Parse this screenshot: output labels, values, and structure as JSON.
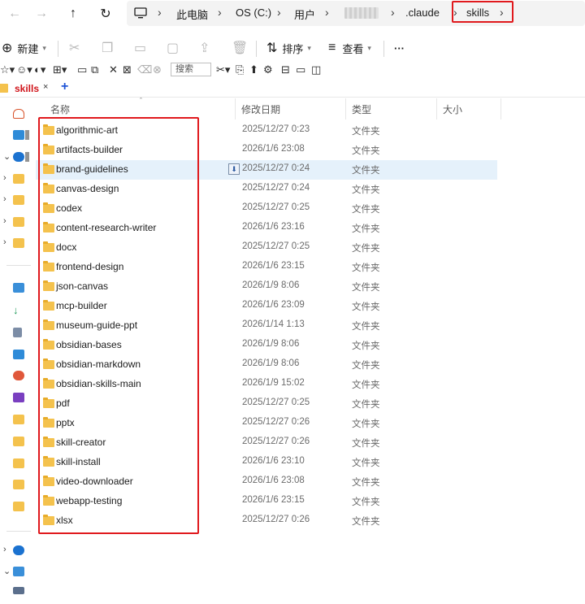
{
  "address_bar": {
    "breadcrumbs": [
      "此电脑",
      "OS (C:)",
      "用户",
      ".claude",
      "skills"
    ],
    "separator": "›"
  },
  "command_bar": {
    "new_label": "新建",
    "sort_label": "排序",
    "view_label": "查看",
    "more_label": "···"
  },
  "mini_toolbar": {
    "search_placeholder": "搜索"
  },
  "tab": {
    "label": "skills",
    "close": "×",
    "add": "+"
  },
  "columns": {
    "name": "名称",
    "modified": "修改日期",
    "type": "类型",
    "size": "大小"
  },
  "files": [
    {
      "name": "algorithmic-art",
      "modified": "2025/12/27 0:23",
      "type": "文件夹"
    },
    {
      "name": "artifacts-builder",
      "modified": "2026/1/6 23:08",
      "type": "文件夹"
    },
    {
      "name": "brand-guidelines",
      "modified": "2025/12/27 0:24",
      "type": "文件夹",
      "selected": true
    },
    {
      "name": "canvas-design",
      "modified": "2025/12/27 0:24",
      "type": "文件夹"
    },
    {
      "name": "codex",
      "modified": "2025/12/27 0:25",
      "type": "文件夹"
    },
    {
      "name": "content-research-writer",
      "modified": "2026/1/6 23:16",
      "type": "文件夹"
    },
    {
      "name": "docx",
      "modified": "2025/12/27 0:25",
      "type": "文件夹"
    },
    {
      "name": "frontend-design",
      "modified": "2026/1/6 23:15",
      "type": "文件夹"
    },
    {
      "name": "json-canvas",
      "modified": "2026/1/9 8:06",
      "type": "文件夹"
    },
    {
      "name": "mcp-builder",
      "modified": "2026/1/6 23:09",
      "type": "文件夹"
    },
    {
      "name": "museum-guide-ppt",
      "modified": "2026/1/14 1:13",
      "type": "文件夹"
    },
    {
      "name": "obsidian-bases",
      "modified": "2026/1/9 8:06",
      "type": "文件夹"
    },
    {
      "name": "obsidian-markdown",
      "modified": "2026/1/9 8:06",
      "type": "文件夹"
    },
    {
      "name": "obsidian-skills-main",
      "modified": "2026/1/9 15:02",
      "type": "文件夹"
    },
    {
      "name": "pdf",
      "modified": "2025/12/27 0:25",
      "type": "文件夹"
    },
    {
      "name": "pptx",
      "modified": "2025/12/27 0:26",
      "type": "文件夹"
    },
    {
      "name": "skill-creator",
      "modified": "2025/12/27 0:26",
      "type": "文件夹"
    },
    {
      "name": "skill-install",
      "modified": "2026/1/6 23:10",
      "type": "文件夹"
    },
    {
      "name": "video-downloader",
      "modified": "2026/1/6 23:08",
      "type": "文件夹"
    },
    {
      "name": "webapp-testing",
      "modified": "2026/1/6 23:15",
      "type": "文件夹"
    },
    {
      "name": "xlsx",
      "modified": "2025/12/27 0:26",
      "type": "文件夹"
    }
  ],
  "colors": {
    "highlight_red": "#e0191d",
    "folder_yellow": "#f4c24d",
    "selected_row": "#e5f1fb",
    "accent_blue": "#1f54d6"
  }
}
